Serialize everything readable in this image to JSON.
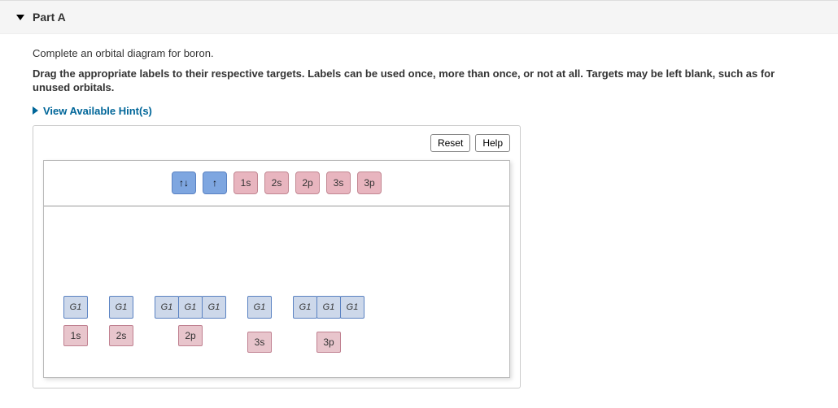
{
  "header": {
    "title": "Part A"
  },
  "instructions": {
    "line1": "Complete an orbital diagram for boron.",
    "line2": "Drag the appropriate labels to their respective targets. Labels can be used once, more than once, or not at all. Targets may be left blank, such as for unused orbitals."
  },
  "hints": {
    "label": "View Available Hint(s)"
  },
  "controls": {
    "reset": "Reset",
    "help": "Help"
  },
  "palette": {
    "arrows_updown": "↑↓",
    "arrow_up": "↑",
    "lbl_1s": "1s",
    "lbl_2s": "2s",
    "lbl_2p": "2p",
    "lbl_3s": "3s",
    "lbl_3p": "3p"
  },
  "target": {
    "placeholder": "G1",
    "groups": {
      "g1": {
        "slots": 1,
        "label": "1s"
      },
      "g2": {
        "slots": 1,
        "label": "2s"
      },
      "g3": {
        "slots": 3,
        "label": "2p"
      },
      "g4": {
        "slots": 1,
        "label": "3s"
      },
      "g5": {
        "slots": 3,
        "label": "3p"
      }
    }
  }
}
